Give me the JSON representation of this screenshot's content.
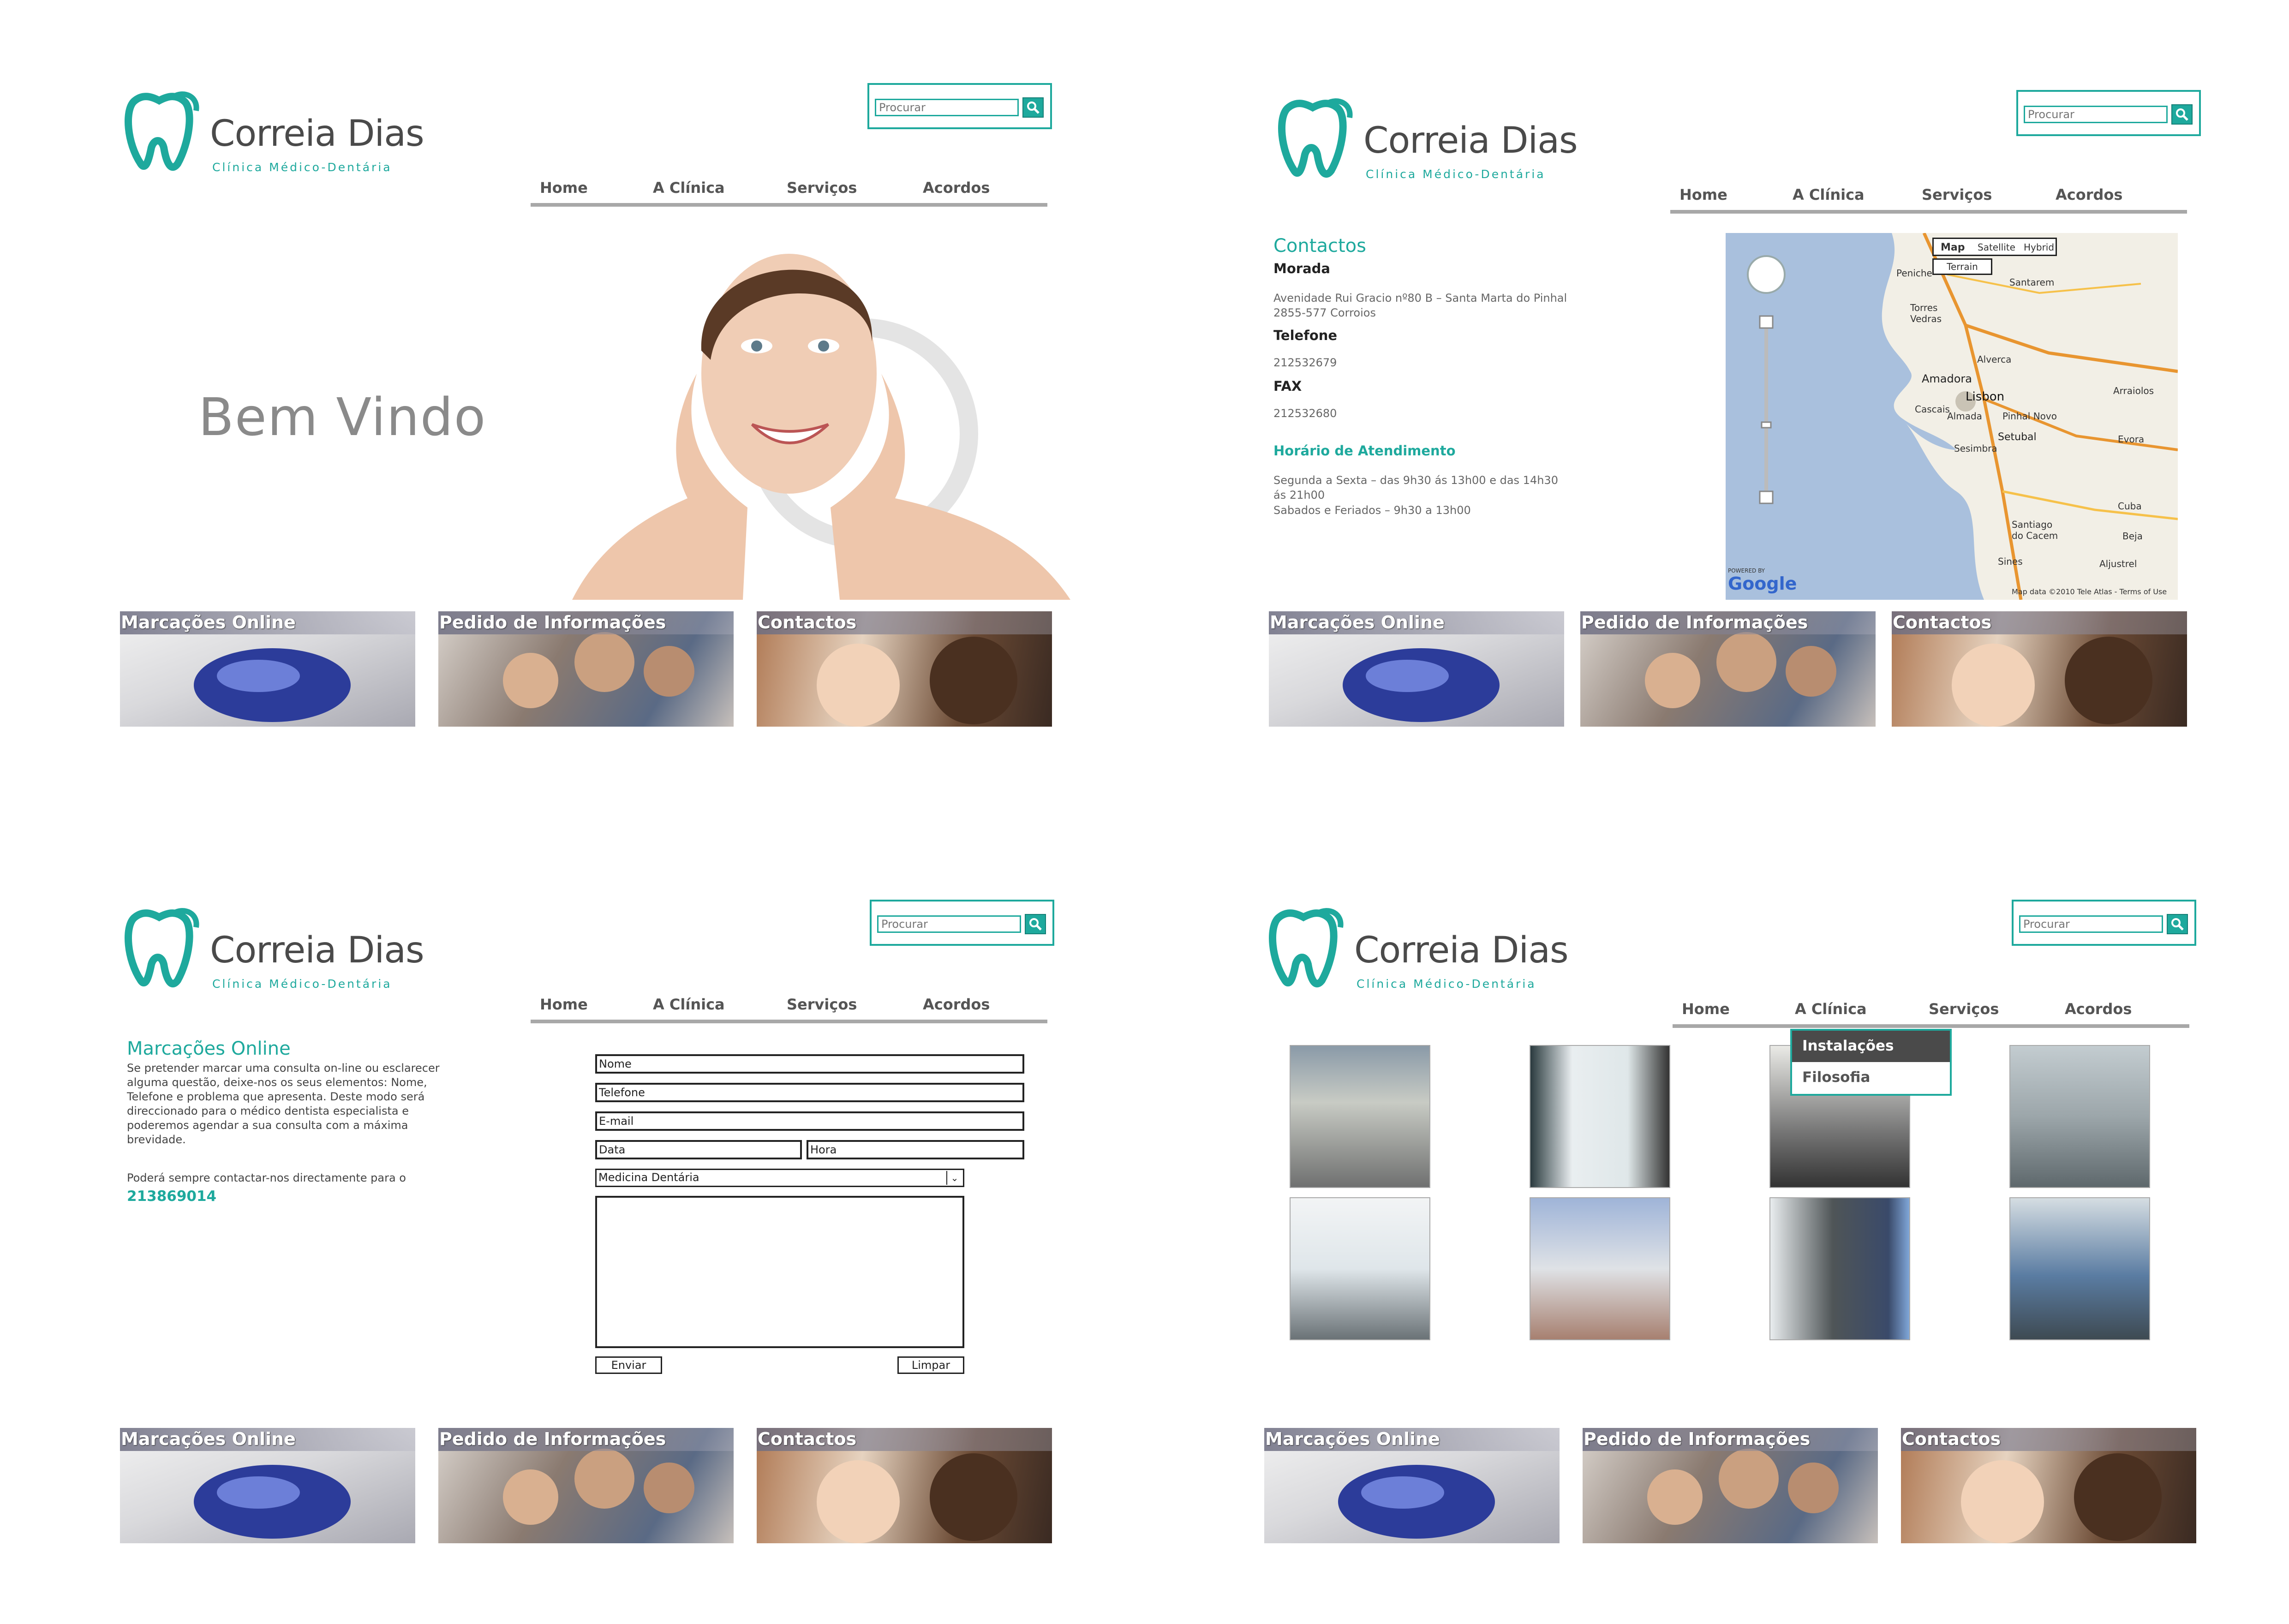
{
  "brand": {
    "name": "Correia Dias",
    "tagline": "Clínica Médico-Dentária",
    "color": "#1ea99d"
  },
  "search": {
    "placeholder": "Procurar",
    "icon": "search-icon"
  },
  "nav": [
    {
      "label": "Home"
    },
    {
      "label": "A Clínica"
    },
    {
      "label": "Serviços"
    },
    {
      "label": "Acordos"
    }
  ],
  "tiles": [
    {
      "label": "Marcações Online"
    },
    {
      "label": "Pedido de Informações"
    },
    {
      "label": "Contactos"
    }
  ],
  "home": {
    "welcome": "Bem Vindo"
  },
  "contacts": {
    "title": "Contactos",
    "address_label": "Morada",
    "address": "Avenidade Rui Gracio nº80 B – Santa Marta do Pinhal 2855-577 Corroios",
    "phone_label": "Telefone",
    "phone": "212532679",
    "fax_label": "FAX",
    "fax": "212532680",
    "hours_title": "Horário de Atendimento",
    "hours_line1": "Segunda a Sexta – das 9h30 ás 13h00 e das 14h30 ás 21h00",
    "hours_line2": "Sabados e Feriados – 9h30 a 13h00",
    "map": {
      "buttons": [
        "Map",
        "Satellite",
        "Hybrid",
        "Terrain"
      ],
      "places": [
        "Santarem",
        "Torres Vedras",
        "Peniche",
        "Alverca",
        "Amadora",
        "Lisbon",
        "Cascais",
        "Almada",
        "Pinhal Novo",
        "Sesimbra",
        "Setubal",
        "Arraiolos",
        "Evora",
        "Cuba",
        "Beja",
        "Santiago do Cacem",
        "Sines",
        "Aljustrel"
      ],
      "credit": "Map data ©2010 Tele Atlas - Terms of Use",
      "logo": "Google",
      "powered": "POWERED BY"
    }
  },
  "booking": {
    "title": "Marcações Online",
    "text": "Se pretender marcar uma consulta on-line ou esclarecer alguma questão, deixe-nos os seus elementos: Nome, Telefone e problema que apresenta. Deste modo será direccionado para o médico dentista especialista e poderemos agendar a sua consulta com a máxima brevidade.",
    "contact_text": "Poderá sempre contactar-nos directamente para o",
    "phone": "213869014",
    "fields": {
      "name": "Nome",
      "phone": "Telefone",
      "email": "E-mail",
      "date": "Data",
      "time": "Hora",
      "specialty": "Medicina Dentária"
    },
    "submit": "Enviar",
    "reset": "Limpar"
  },
  "clinic_menu": [
    {
      "label": "Instalações"
    },
    {
      "label": "Filosofia"
    }
  ]
}
